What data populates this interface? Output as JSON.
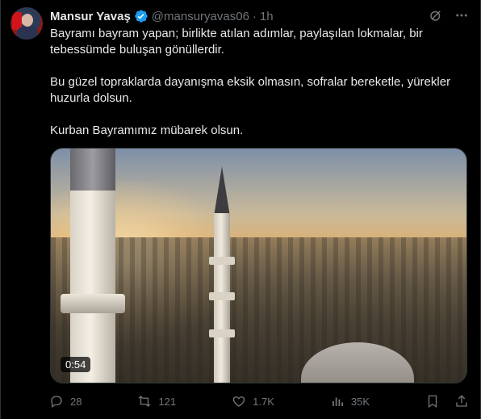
{
  "author": {
    "name": "Mansur Yavaş",
    "handle": "@mansuryavas06",
    "separator": "·",
    "time": "1h"
  },
  "post": {
    "paragraphs": [
      "Bayramı bayram yapan; birlikte atılan adımlar, paylaşılan lokmalar, bir tebessümde buluşan gönüllerdir.",
      "Bu güzel topraklarda dayanışma eksik olmasın, sofralar bereketle, yürekler huzurla dolsun.",
      "Kurban Bayramımız mübarek olsun."
    ]
  },
  "media": {
    "duration": "0:54"
  },
  "actions": {
    "replies": "28",
    "reposts": "121",
    "likes": "1.7K",
    "views": "35K"
  },
  "icons": {
    "verified": "verified-badge-icon",
    "grok": "grok-icon",
    "more": "more-icon",
    "reply": "reply-icon",
    "repost": "repost-icon",
    "like": "heart-icon",
    "views": "views-icon",
    "bookmark": "bookmark-icon",
    "share": "share-icon"
  },
  "colors": {
    "background": "#000000",
    "text": "#e7e9ea",
    "muted": "#71767b",
    "verified": "#1d9bf0"
  }
}
